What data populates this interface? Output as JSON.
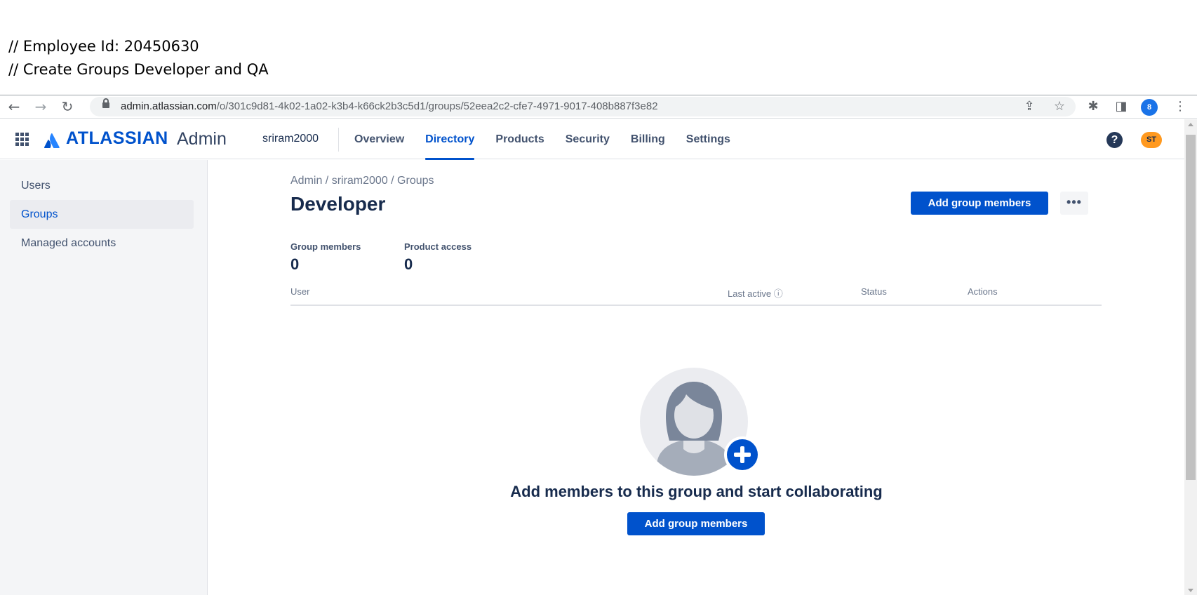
{
  "annotations": {
    "line1": "// Employee Id: 20450630",
    "line2": "// Create Groups Developer and QA"
  },
  "browser": {
    "url_host": "admin.atlassian.com",
    "url_path": "/o/301c9d81-4k02-1a02-k3b4-k66ck2b3c5d1/groups/52eea2c2-cfe7-4971-9017-408b887f3e82",
    "profile_initial": "8",
    "icons": [
      "back-icon",
      "forward-icon",
      "reload-icon",
      "lock-icon",
      "share-icon",
      "star-icon",
      "extensions-icon",
      "sidepanel-icon",
      "menu-icon"
    ]
  },
  "header": {
    "logo_text": "ATLASSIAN",
    "logo_product": "Admin",
    "org": "sriram2000",
    "nav": [
      {
        "label": "Overview"
      },
      {
        "label": "Directory"
      },
      {
        "label": "Products"
      },
      {
        "label": "Security"
      },
      {
        "label": "Billing"
      },
      {
        "label": "Settings"
      }
    ],
    "active_nav": "Directory",
    "help": "?",
    "avatar_initials": "ST"
  },
  "sidebar": {
    "items": [
      {
        "label": "Users"
      },
      {
        "label": "Groups"
      },
      {
        "label": "Managed accounts"
      }
    ],
    "active": "Groups"
  },
  "main": {
    "breadcrumb": "Admin  /  sriram2000  /  Groups",
    "title": "Developer",
    "add_members_label": "Add group members",
    "more_label": "•••",
    "stats": {
      "members_label": "Group members",
      "members_value": "0",
      "access_label": "Product access",
      "access_value": "0"
    },
    "table_headers": {
      "user": "User",
      "last_active": "Last active ⓘ",
      "status": "Status",
      "actions": "Actions"
    },
    "empty_text": "Add members to this group and start collaborating",
    "empty_button": "Add group members"
  },
  "colors": {
    "brand": "#0052cc",
    "text": "#172b4d",
    "sidebar_bg": "#f4f5f7",
    "avatar": "#ff991f"
  }
}
